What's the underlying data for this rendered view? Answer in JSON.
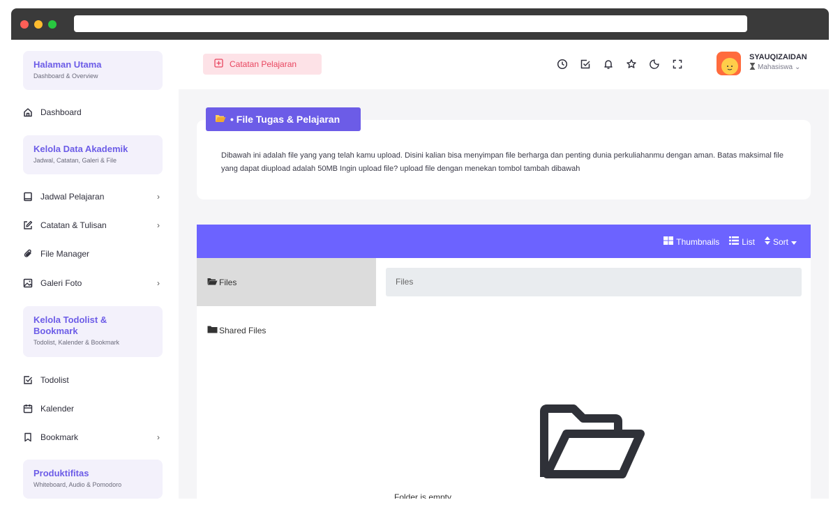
{
  "sidebar": {
    "sections": [
      {
        "title": "Halaman Utama",
        "subtitle": "Dashboard & Overview"
      },
      {
        "title": "Kelola Data Akademik",
        "subtitle": "Jadwal, Catatan, Galeri & File"
      },
      {
        "title": "Kelola Todolist & Bookmark",
        "subtitle": "Todolist, Kalender & Bookmark"
      },
      {
        "title": "Produktifitas",
        "subtitle": "Whiteboard, Audio & Pomodoro"
      }
    ],
    "items": {
      "dashboard": "Dashboard",
      "jadwal": "Jadwal Pelajaran",
      "catatan": "Catatan & Tulisan",
      "file_manager": "File Manager",
      "galeri": "Galeri Foto",
      "todolist": "Todolist",
      "kalender": "Kalender",
      "bookmark": "Bookmark"
    }
  },
  "topbar": {
    "catatan_button": "Catatan Pelajaran",
    "username": "SYAUQIZAIDAN",
    "role": "Mahasiswa"
  },
  "page": {
    "badge": "• File Tugas & Pelajaran",
    "description": "Dibawah ini adalah file yang yang telah kamu upload. Disini kalian bisa menyimpan file berharga dan penting dunia perkuliahanmu dengan aman. Batas maksimal file yang dapat diupload adalah 50MB Ingin upload file? upload file dengan menekan tombol tambah dibawah"
  },
  "file_manager": {
    "view_thumbnails": "Thumbnails",
    "view_list": "List",
    "sort": "Sort",
    "folders": {
      "files": "Files",
      "shared": "Shared Files"
    },
    "path": "Files",
    "empty": "Folder is empty"
  },
  "colors": {
    "accent": "#6c5ce7",
    "header": "#6c63ff",
    "pink_btn": "#fde2e7"
  }
}
